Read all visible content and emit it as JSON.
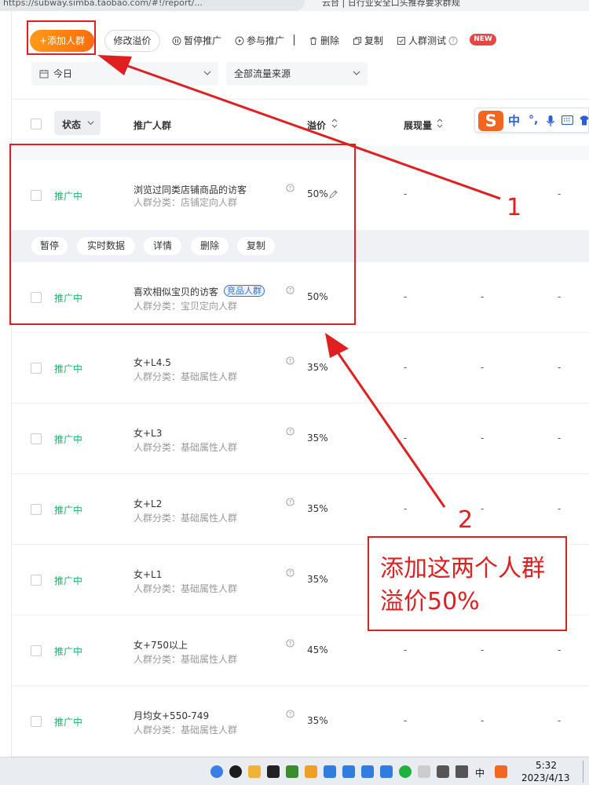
{
  "browser": {
    "url": "https://subway.simba.taobao.com/#!/report/...",
    "tab_title": "云台 | 日行业安全口头推荐要求群规"
  },
  "toolbar": {
    "add_crowd": "+添加人群",
    "modify_premium": "修改溢价",
    "pause": "暂停推广",
    "join": "参与推广",
    "delete": "删除",
    "copy": "复制",
    "crowd_test": "人群测试",
    "new_badge": "NEW"
  },
  "filters": {
    "date": "今日",
    "traffic": "全部流量来源"
  },
  "table": {
    "headers": {
      "status": "状态",
      "crowd": "推广人群",
      "premium": "溢价",
      "impressions": "展现量"
    },
    "row_actions": [
      "暂停",
      "实时数据",
      "详情",
      "删除",
      "复制"
    ],
    "rows": [
      {
        "status": "推广中",
        "name": "浏览过同类店铺商品的访客",
        "category": "人群分类：店铺定向人群",
        "premium": "50%",
        "tag": "",
        "dash1": "-",
        "dash2": "",
        "dash3": "-"
      },
      {
        "status": "推广中",
        "name": "喜欢相似宝贝的访客",
        "category": "人群分类：宝贝定向人群",
        "premium": "50%",
        "tag": "竞品人群",
        "dash1": "-",
        "dash2": "-",
        "dash3": "-"
      },
      {
        "status": "推广中",
        "name": "女+L4.5",
        "category": "人群分类：基础属性人群",
        "premium": "35%",
        "tag": "",
        "dash1": "-",
        "dash2": "-",
        "dash3": "-"
      },
      {
        "status": "推广中",
        "name": "女+L3",
        "category": "人群分类：基础属性人群",
        "premium": "35%",
        "tag": "",
        "dash1": "-",
        "dash2": "-",
        "dash3": "-"
      },
      {
        "status": "推广中",
        "name": "女+L2",
        "category": "人群分类：基础属性人群",
        "premium": "35%",
        "tag": "",
        "dash1": "-",
        "dash2": "-",
        "dash3": "-"
      },
      {
        "status": "推广中",
        "name": "女+L1",
        "category": "人群分类：基础属性人群",
        "premium": "35%",
        "tag": "",
        "dash1": "-",
        "dash2": "",
        "dash3": ""
      },
      {
        "status": "推广中",
        "name": "女+750以上",
        "category": "人群分类：基础属性人群",
        "premium": "45%",
        "tag": "",
        "dash1": "-",
        "dash2": "-",
        "dash3": "-"
      },
      {
        "status": "推广中",
        "name": "月均女+550-749",
        "category": "人群分类：基础属性人群",
        "premium": "35%",
        "tag": "",
        "dash1": "-",
        "dash2": "-",
        "dash3": "-"
      }
    ]
  },
  "ime": {
    "logo": "S",
    "mode": "中"
  },
  "annotations": {
    "label1": "1",
    "label2": "2",
    "note_line1": "添加这两个人群",
    "note_line2": "溢价50%",
    "color": "#e02020"
  },
  "taskbar": {
    "ime_indicator": "中",
    "time": "5:32",
    "date": "2023/4/13"
  }
}
